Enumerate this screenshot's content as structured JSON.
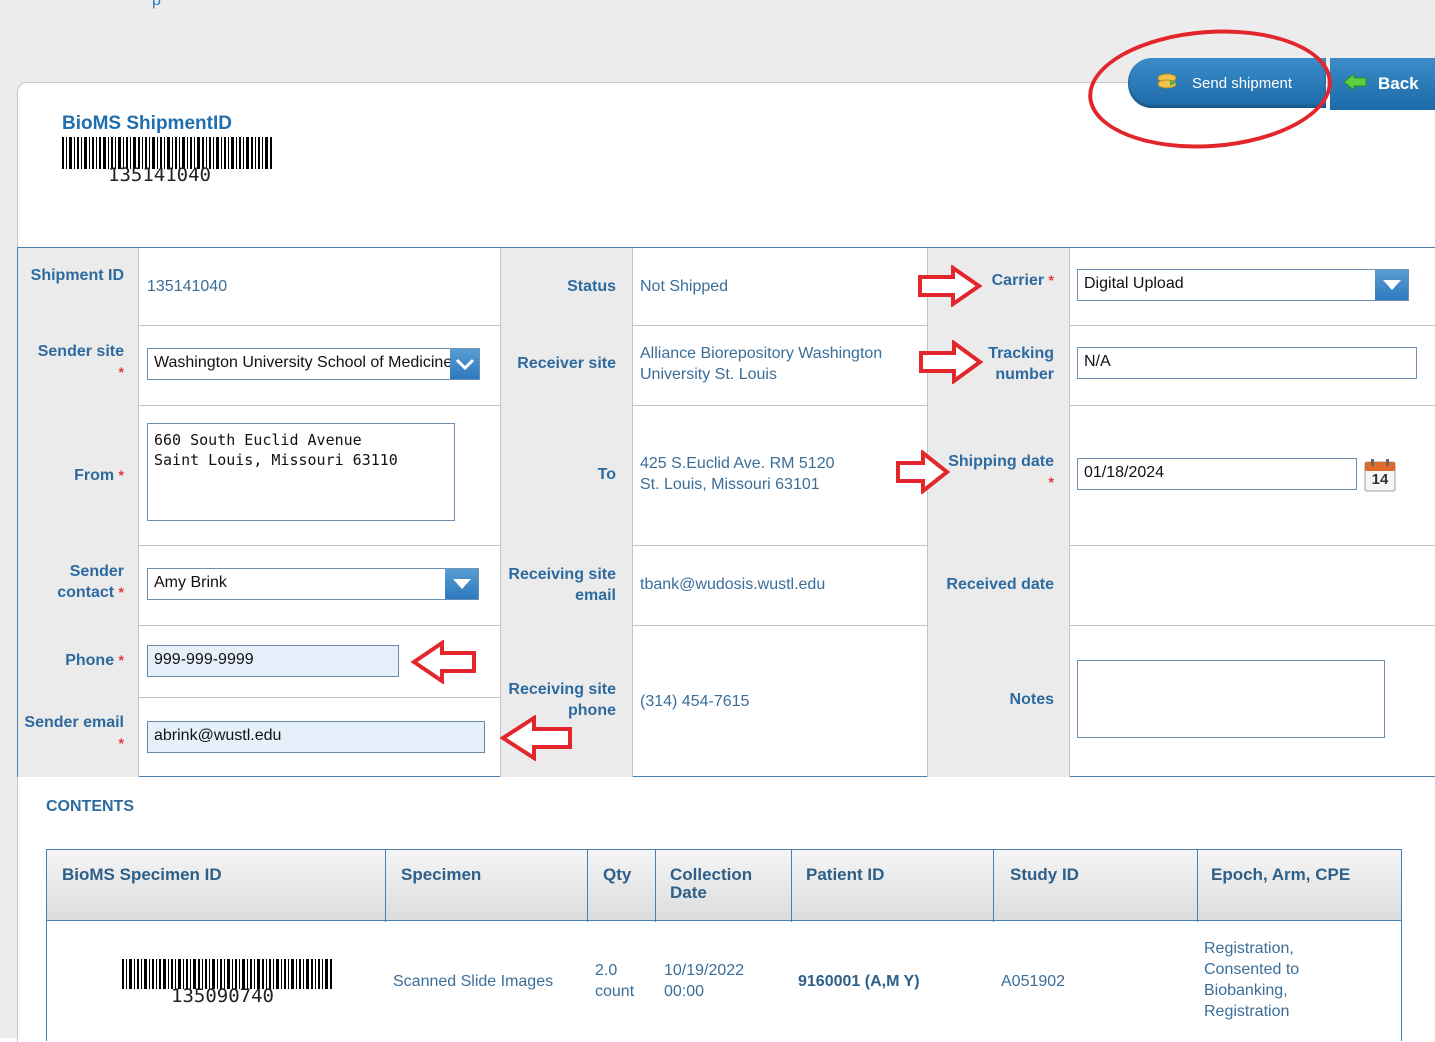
{
  "header": {
    "top_text": "p",
    "shipment_id_title": "BioMS ShipmentID",
    "shipment_barcode_number": "135141040",
    "send_shipment_label": "Send shipment",
    "back_label": "Back"
  },
  "form": {
    "shipment_id_label": "Shipment ID",
    "shipment_id_value": "135141040",
    "sender_site_label": "Sender site",
    "sender_site_value": "Washington University School of Medicine (",
    "from_label": "From",
    "from_value": "660 South Euclid Avenue\nSaint Louis, Missouri 63110",
    "sender_contact_label": "Sender contact",
    "sender_contact_value": "Amy Brink",
    "phone_label": "Phone",
    "phone_value": "999-999-9999",
    "sender_email_label": "Sender email",
    "sender_email_value": "abrink@wustl.edu",
    "status_label": "Status",
    "status_value": "Not Shipped",
    "receiver_site_label": "Receiver site",
    "receiver_site_value": "Alliance Biorepository Washington University St. Louis",
    "to_label": "To",
    "to_value_line1": "425 S.Euclid Ave. RM 5120",
    "to_value_line2": "St. Louis, Missouri 63101",
    "receiving_site_email_label": "Receiving site email",
    "receiving_site_email_value": "tbank@wudosis.wustl.edu",
    "receiving_site_phone_label": "Receiving site phone",
    "receiving_site_phone_value": "(314) 454-7615",
    "carrier_label": "Carrier",
    "carrier_value": "Digital Upload",
    "tracking_number_label": "Tracking number",
    "tracking_number_value": "N/A",
    "shipping_date_label": "Shipping date",
    "shipping_date_value": "01/18/2024",
    "calendar_day": "14",
    "received_date_label": "Received date",
    "notes_label": "Notes",
    "notes_value": ""
  },
  "contents": {
    "title": "CONTENTS",
    "columns": [
      "BioMS Specimen ID",
      "Specimen",
      "Qty",
      "Collection Date",
      "Patient ID",
      "Study ID",
      "Epoch, Arm, CPE"
    ],
    "rows": [
      {
        "specimen_barcode_number": "135090740",
        "specimen": "Scanned Slide Images",
        "qty_line1": "2.0",
        "qty_line2": "count",
        "collection_date_line1": "10/19/2022",
        "collection_date_line2": "00:00",
        "patient_id": "9160001 (A,M Y)",
        "study_id": "A051902",
        "epoch_arm_cpe": "Registration, Consented to Biobanking, Registration"
      }
    ]
  },
  "colors": {
    "accent_blue": "#1f6fb0",
    "annotation_red": "#e3262b"
  }
}
